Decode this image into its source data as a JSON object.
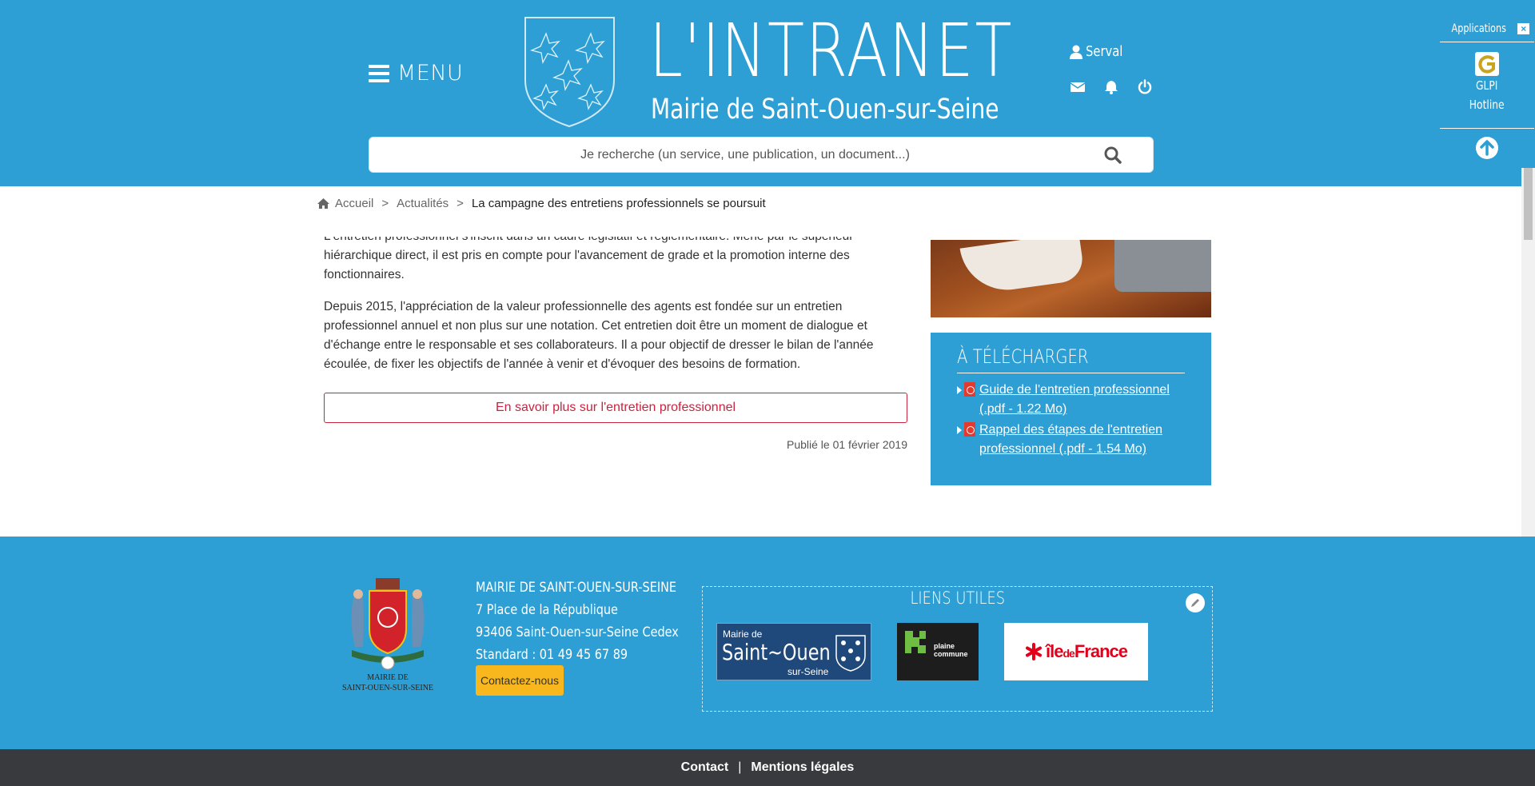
{
  "header": {
    "menu_label": "MENU",
    "site_title": "L'INTRANET",
    "site_subtitle": "Mairie de Saint-Ouen-sur-Seine",
    "user_name": "Serval",
    "search_placeholder": "Je recherche (un service, une publication, un document...)"
  },
  "applications": {
    "title": "Applications",
    "close": "×",
    "item_name": "GLPI",
    "item_sub": "Hotline"
  },
  "breadcrumb": {
    "home": "Accueil",
    "sep": ">",
    "section": "Actualités",
    "current": "La campagne des entretiens professionnels se poursuit"
  },
  "article": {
    "paragraph1": "L'entretien professionnel s'inscrit dans un cadre législatif et réglementaire. Mené par le supérieur hiérarchique direct, il est pris en compte pour l'avancement de grade et la promotion interne des fonctionnaires.",
    "paragraph2": "Depuis 2015, l'appréciation de la valeur professionnelle des agents est fondée sur un entretien professionnel annuel et non plus sur une notation. Cet entretien doit être un moment de dialogue et d'échange entre le responsable et ses collaborateurs. Il a pour objectif de dresser le bilan de l'année écoulée, de fixer les objectifs de l'année à venir et d'évoquer des besoins de formation.",
    "more_button": "En savoir plus sur l'entretien professionnel",
    "published": "Publié le 01 février 2019"
  },
  "downloads": {
    "title": "À TÉLÉCHARGER",
    "items": [
      {
        "label": "Guide de l'entretien professionnel (.pdf - 1.22 Mo)"
      },
      {
        "label": "Rappel des étapes de l'entretien professionnel (.pdf - 1.54 Mo)"
      }
    ]
  },
  "footer": {
    "logo_line1": "MAIRIE DE",
    "logo_line2": "SAINT-OUEN-SUR-SEINE",
    "org_name": "MAIRIE DE SAINT-OUEN-SUR-SEINE",
    "address1": "7 Place de la République",
    "address2": "93406 Saint-Ouen-sur-Seine Cedex",
    "phone": "Standard : 01 49 45 67 89",
    "contact_button": "Contactez-nous",
    "links_title": "LIENS UTILES",
    "link_saint_ouen": {
      "line1": "Mairie de",
      "line2": "Saint~Ouen",
      "line3": "sur-Seine"
    },
    "link_plaine": {
      "line1": "plaine",
      "line2": "commune"
    },
    "link_idf": {
      "prefix": "île",
      "mid": "de",
      "suffix": "France"
    }
  },
  "bottom": {
    "contact": "Contact",
    "sep": "|",
    "legal": "Mentions légales"
  },
  "colors": {
    "brand_blue": "#2d9fd4",
    "accent_red": "#c9243f",
    "button_yellow": "#f8b81d",
    "bottom_bar": "#393a3d"
  }
}
